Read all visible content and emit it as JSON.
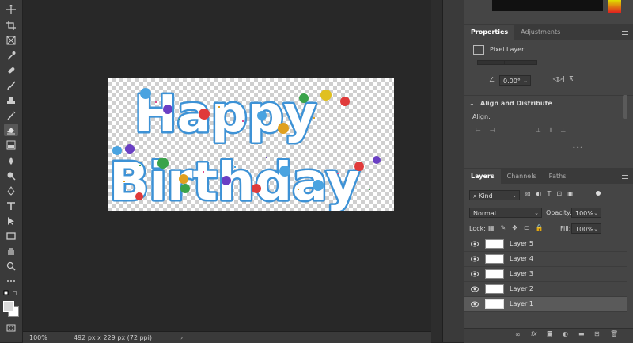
{
  "toolbar": {
    "tools": [
      "move-tool",
      "lasso-tool",
      "crop-tool",
      "frame-tool",
      "eyedropper-tool",
      "healing-brush-tool",
      "brush-tool",
      "clone-stamp-tool",
      "history-brush-tool",
      "eraser-tool",
      "gradient-tool",
      "blur-tool",
      "dodge-tool",
      "pen-tool",
      "type-tool",
      "path-selection-tool",
      "rectangle-tool",
      "hand-tool",
      "zoom-tool",
      "more-tools"
    ],
    "active_tool": "eraser-tool"
  },
  "document": {
    "canvas_text_line1": "Happy",
    "canvas_text_line2": "Birthday"
  },
  "status": {
    "zoom": "100%",
    "doc_info": "492 px x 229 px (72 ppi)"
  },
  "properties_panel": {
    "tabs": [
      "Properties",
      "Adjustments"
    ],
    "active_tab": "Properties",
    "layer_type": "Pixel Layer",
    "angle_value": "0.00°",
    "align_section_title": "Align and Distribute",
    "align_label": "Align:"
  },
  "layers_panel": {
    "tabs": [
      "Layers",
      "Channels",
      "Paths"
    ],
    "active_tab": "Layers",
    "filter_kind": "Kind",
    "blend_mode": "Normal",
    "opacity_label": "Opacity:",
    "opacity_value": "100%",
    "lock_label": "Lock:",
    "fill_label": "Fill:",
    "fill_value": "100%",
    "layers": [
      {
        "name": "Layer 5",
        "selected": false
      },
      {
        "name": "Layer 4",
        "selected": false
      },
      {
        "name": "Layer 3",
        "selected": false
      },
      {
        "name": "Layer 2",
        "selected": false
      },
      {
        "name": "Layer 1",
        "selected": true
      }
    ]
  },
  "colors": {
    "accent_letters": "#4aa3e0",
    "panel_bg": "#454545",
    "selected_row": "#5a5a5a"
  }
}
